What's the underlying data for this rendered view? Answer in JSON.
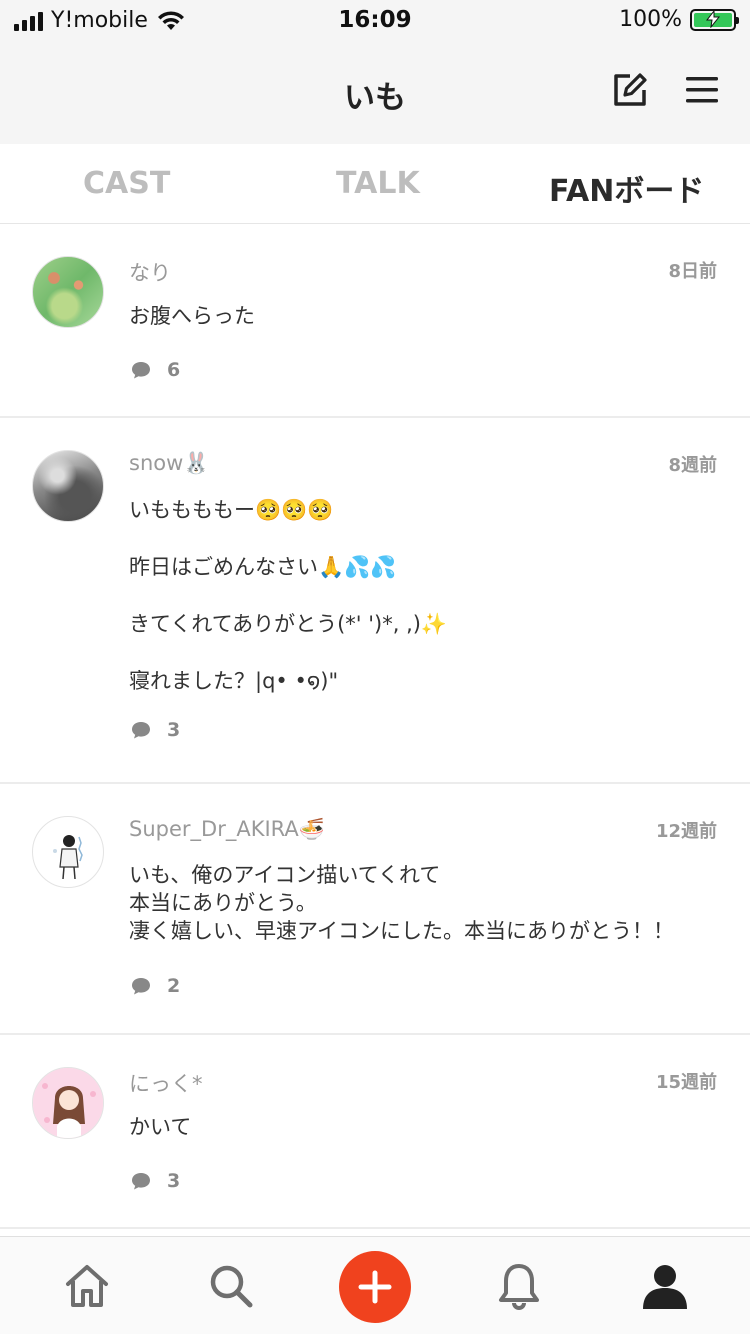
{
  "status_bar": {
    "carrier": "Y!mobile",
    "time": "16:09",
    "battery_percent": "100%"
  },
  "header": {
    "title": "いも",
    "icons": [
      "edit-icon",
      "menu-icon"
    ]
  },
  "tabs": [
    {
      "label": "CAST",
      "active": false
    },
    {
      "label": "TALK",
      "active": false
    },
    {
      "label": "FANボード",
      "active": true
    }
  ],
  "posts": [
    {
      "author": "なり",
      "time": "8日前",
      "body": "お腹へらった",
      "comment_count": "6"
    },
    {
      "author": "snow🐰",
      "time": "8週前",
      "body": "いももももー🥺🥺🥺\n昨日はごめんなさい🙏💦💦\nきてくれてありがとう(*' ')*, ,)✨\n寝れました？|q• •໑)\"",
      "comment_count": "3"
    },
    {
      "author": "Super_Dr_AKIRA🍜",
      "time": "12週前",
      "body": "いも、俺のアイコン描いてくれて\n本当にありがとう。\n凄く嬉しい、早速アイコンにした。本当にありがとう！！",
      "comment_count": "2"
    },
    {
      "author": "にっく*",
      "time": "15週前",
      "body": "かいて",
      "comment_count": "3"
    }
  ],
  "bottom_nav": {
    "items": [
      "home-icon",
      "search-icon",
      "add-icon",
      "bell-icon",
      "profile-icon"
    ],
    "accent_color": "#f0421e"
  }
}
